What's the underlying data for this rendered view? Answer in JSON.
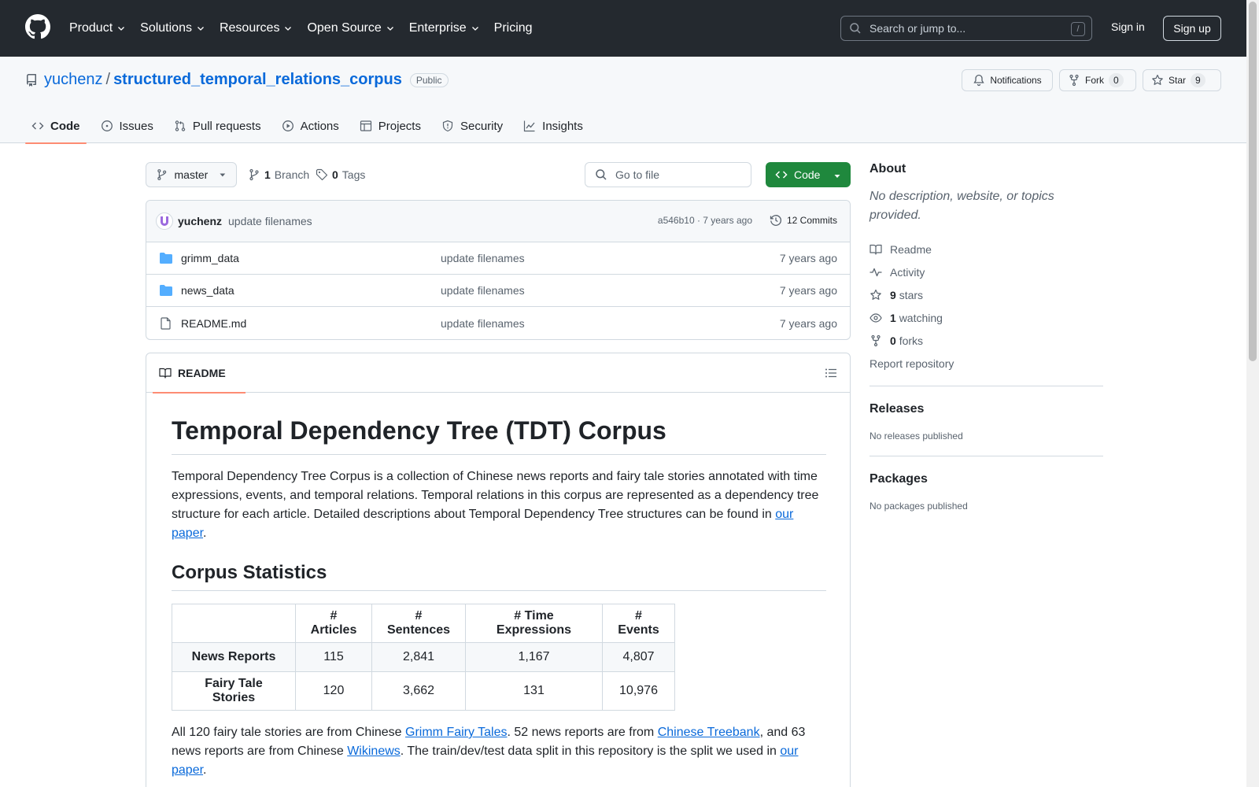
{
  "header": {
    "nav": [
      {
        "label": "Product"
      },
      {
        "label": "Solutions"
      },
      {
        "label": "Resources"
      },
      {
        "label": "Open Source"
      },
      {
        "label": "Enterprise"
      },
      {
        "label": "Pricing"
      }
    ],
    "search_placeholder": "Search or jump to...",
    "search_shortcut": "/",
    "sign_in": "Sign in",
    "sign_up": "Sign up"
  },
  "repo": {
    "owner": "yuchenz",
    "separator": "/",
    "name": "structured_temporal_relations_corpus",
    "visibility": "Public",
    "notifications_label": "Notifications",
    "fork_label": "Fork",
    "fork_count": "0",
    "star_label": "Star",
    "star_count": "9",
    "tabs": [
      {
        "label": "Code"
      },
      {
        "label": "Issues"
      },
      {
        "label": "Pull requests"
      },
      {
        "label": "Actions"
      },
      {
        "label": "Projects"
      },
      {
        "label": "Security"
      },
      {
        "label": "Insights"
      }
    ]
  },
  "toolbar": {
    "branch": "master",
    "branch_count": "1",
    "branch_word": "Branch",
    "tag_count": "0",
    "tag_word": "Tags",
    "goto_placeholder": "Go to file",
    "code_label": "Code"
  },
  "commit": {
    "author": "yuchenz",
    "message": "update filenames",
    "meta": "a546b10 · 7 years ago",
    "count": "12 Commits"
  },
  "files": [
    {
      "name": "grimm_data",
      "type": "folder",
      "message": "update filenames",
      "time": "7 years ago"
    },
    {
      "name": "news_data",
      "type": "folder",
      "message": "update filenames",
      "time": "7 years ago"
    },
    {
      "name": "README.md",
      "type": "file",
      "message": "update filenames",
      "time": "7 years ago"
    }
  ],
  "readme": {
    "tab_label": "README",
    "title": "Temporal Dependency Tree (TDT) Corpus",
    "intro": "Temporal Dependency Tree Corpus is a collection of Chinese news reports and fairy tale stories annotated with time expressions, events, and temporal relations. Temporal relations in this corpus are represented as a dependency tree structure for each article. Detailed descriptions about Temporal Dependency Tree structures can be found in ",
    "intro_link": "our paper",
    "intro_end": ".",
    "stats_heading": "Corpus Statistics",
    "table": {
      "headers": [
        "",
        "# Articles",
        "# Sentences",
        "# Time Expressions",
        "# Events"
      ],
      "rows": [
        [
          "News Reports",
          "115",
          "2,841",
          "1,167",
          "4,807"
        ],
        [
          "Fairy Tale Stories",
          "120",
          "3,662",
          "131",
          "10,976"
        ]
      ]
    },
    "p2_a": "All 120 fairy tale stories are from Chinese ",
    "p2_link1": "Grimm Fairy Tales",
    "p2_b": ". 52 news reports are from ",
    "p2_link2": "Chinese Treebank",
    "p2_c": ", and 63 news reports are from Chinese ",
    "p2_link3": "Wikinews",
    "p2_d": ". The train/dev/test data split in this repository is the split we used in ",
    "p2_link4": "our paper",
    "p2_e": "."
  },
  "sidebar": {
    "about_title": "About",
    "about_desc": "No description, website, or topics provided.",
    "readme": "Readme",
    "activity": "Activity",
    "stars_count": "9",
    "stars_word": "stars",
    "watching_count": "1",
    "watching_word": "watching",
    "forks_count": "0",
    "forks_word": "forks",
    "report": "Report repository",
    "releases_title": "Releases",
    "releases_sub": "No releases published",
    "packages_title": "Packages",
    "packages_sub": "No packages published"
  },
  "colors": {
    "header_bg": "#24292f",
    "link": "#0969da",
    "code_button": "#1f883d",
    "active_tab_underline": "#fd8c73",
    "folder": "#54aeff"
  }
}
